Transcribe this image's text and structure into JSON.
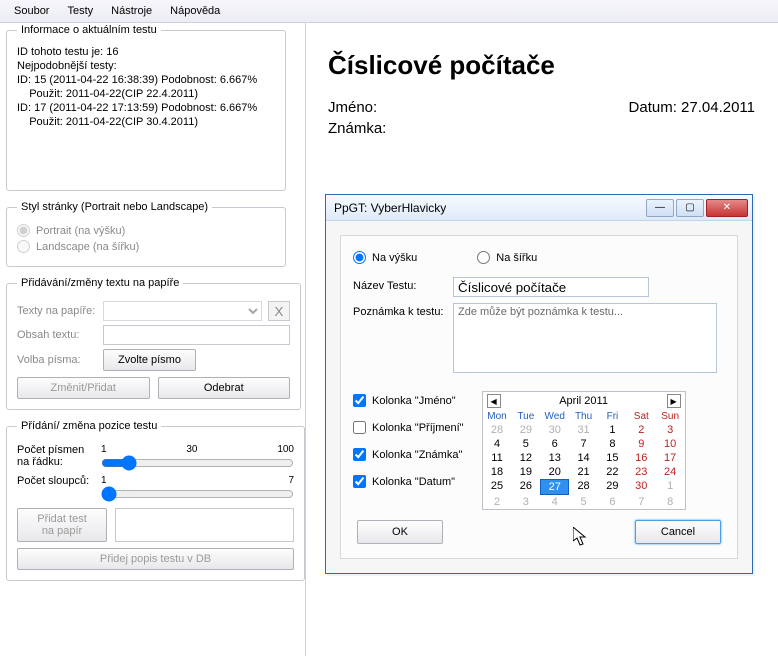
{
  "menu": {
    "file": "Soubor",
    "tests": "Testy",
    "tools": "Nástroje",
    "help": "Nápověda"
  },
  "info": {
    "legend": "Informace o aktuálním testu",
    "id_label": "ID tohoto testu je: 16",
    "most_similar_label": "Nejpodobnější testy:",
    "lines": [
      "ID: 15 (2011-04-22 16:38:39) Podobnost: 6.667%",
      "    Použit: 2011-04-22(CIP 22.4.2011)",
      "ID: 17 (2011-04-22 17:13:59) Podobnost: 6.667%",
      "    Použit: 2011-04-22(CIP 30.4.2011)"
    ]
  },
  "style": {
    "legend": "Styl stránky (Portrait nebo Landscape)",
    "portrait": "Portrait (na výšku)",
    "landscape": "Landscape (na šířku)"
  },
  "textedit": {
    "legend": "Přidávání/změny textu na papíře",
    "texts_label": "Texty na papíře:",
    "content_label": "Obsah textu:",
    "font_label": "Volba písma:",
    "font_btn": "Zvolte písmo",
    "change_btn": "Změnit/Přidat",
    "remove_btn": "Odebrat",
    "x_btn": "X"
  },
  "pos": {
    "legend": "Přídání/ změna pozice testu",
    "letters_label": "Počet písmen na řádku:",
    "cols_label": "Počet sloupců:",
    "ticks1": [
      "1",
      "30",
      "100"
    ],
    "ticks2": [
      "1",
      "7"
    ],
    "add_btn": "Přidat test na papír",
    "db_btn": "Přidej popis testu v DB"
  },
  "doc": {
    "title": "Číslicové počítače",
    "jmeno": "Jméno:",
    "datum_label": "Datum: 27.04.2011",
    "znamka": "Známka:"
  },
  "dialog": {
    "title": "PpGT: VyberHlavicky",
    "na_vysku": "Na výšku",
    "na_sirku": "Na šířku",
    "nazev_label": "Název Testu:",
    "nazev_value": "Číslicové počítače",
    "poznamka_label": "Poznámka k testu:",
    "poznamka_ph": "Zde může být poznámka k testu...",
    "kolonky": [
      "Kolonka \"Jméno\"",
      "Kolonka \"Příjmení\"",
      "Kolonka \"Známka\"",
      "Kolonka \"Datum\""
    ],
    "kolonky_checked": [
      true,
      false,
      true,
      true
    ],
    "ok": "OK",
    "cancel": "Cancel"
  },
  "calendar": {
    "title": "April 2011",
    "dow": [
      "Mon",
      "Tue",
      "Wed",
      "Thu",
      "Fri",
      "Sat",
      "Sun"
    ],
    "weeks": [
      [
        {
          "d": 28,
          "o": true
        },
        {
          "d": 29,
          "o": true
        },
        {
          "d": 30,
          "o": true
        },
        {
          "d": 31,
          "o": true
        },
        {
          "d": 1
        },
        {
          "d": 2,
          "w": true
        },
        {
          "d": 3,
          "w": true
        }
      ],
      [
        {
          "d": 4
        },
        {
          "d": 5
        },
        {
          "d": 6
        },
        {
          "d": 7
        },
        {
          "d": 8
        },
        {
          "d": 9,
          "w": true
        },
        {
          "d": 10,
          "w": true
        }
      ],
      [
        {
          "d": 11
        },
        {
          "d": 12
        },
        {
          "d": 13
        },
        {
          "d": 14
        },
        {
          "d": 15
        },
        {
          "d": 16,
          "w": true
        },
        {
          "d": 17,
          "w": true
        }
      ],
      [
        {
          "d": 18
        },
        {
          "d": 19
        },
        {
          "d": 20
        },
        {
          "d": 21
        },
        {
          "d": 22
        },
        {
          "d": 23,
          "w": true
        },
        {
          "d": 24,
          "w": true
        }
      ],
      [
        {
          "d": 25
        },
        {
          "d": 26
        },
        {
          "d": 27,
          "sel": true
        },
        {
          "d": 28
        },
        {
          "d": 29
        },
        {
          "d": 30,
          "w": true
        },
        {
          "d": 1,
          "o": true
        }
      ],
      [
        {
          "d": 2,
          "o": true
        },
        {
          "d": 3,
          "o": true
        },
        {
          "d": 4,
          "o": true
        },
        {
          "d": 5,
          "o": true
        },
        {
          "d": 6,
          "o": true
        },
        {
          "d": 7,
          "o": true
        },
        {
          "d": 8,
          "o": true
        }
      ]
    ]
  }
}
